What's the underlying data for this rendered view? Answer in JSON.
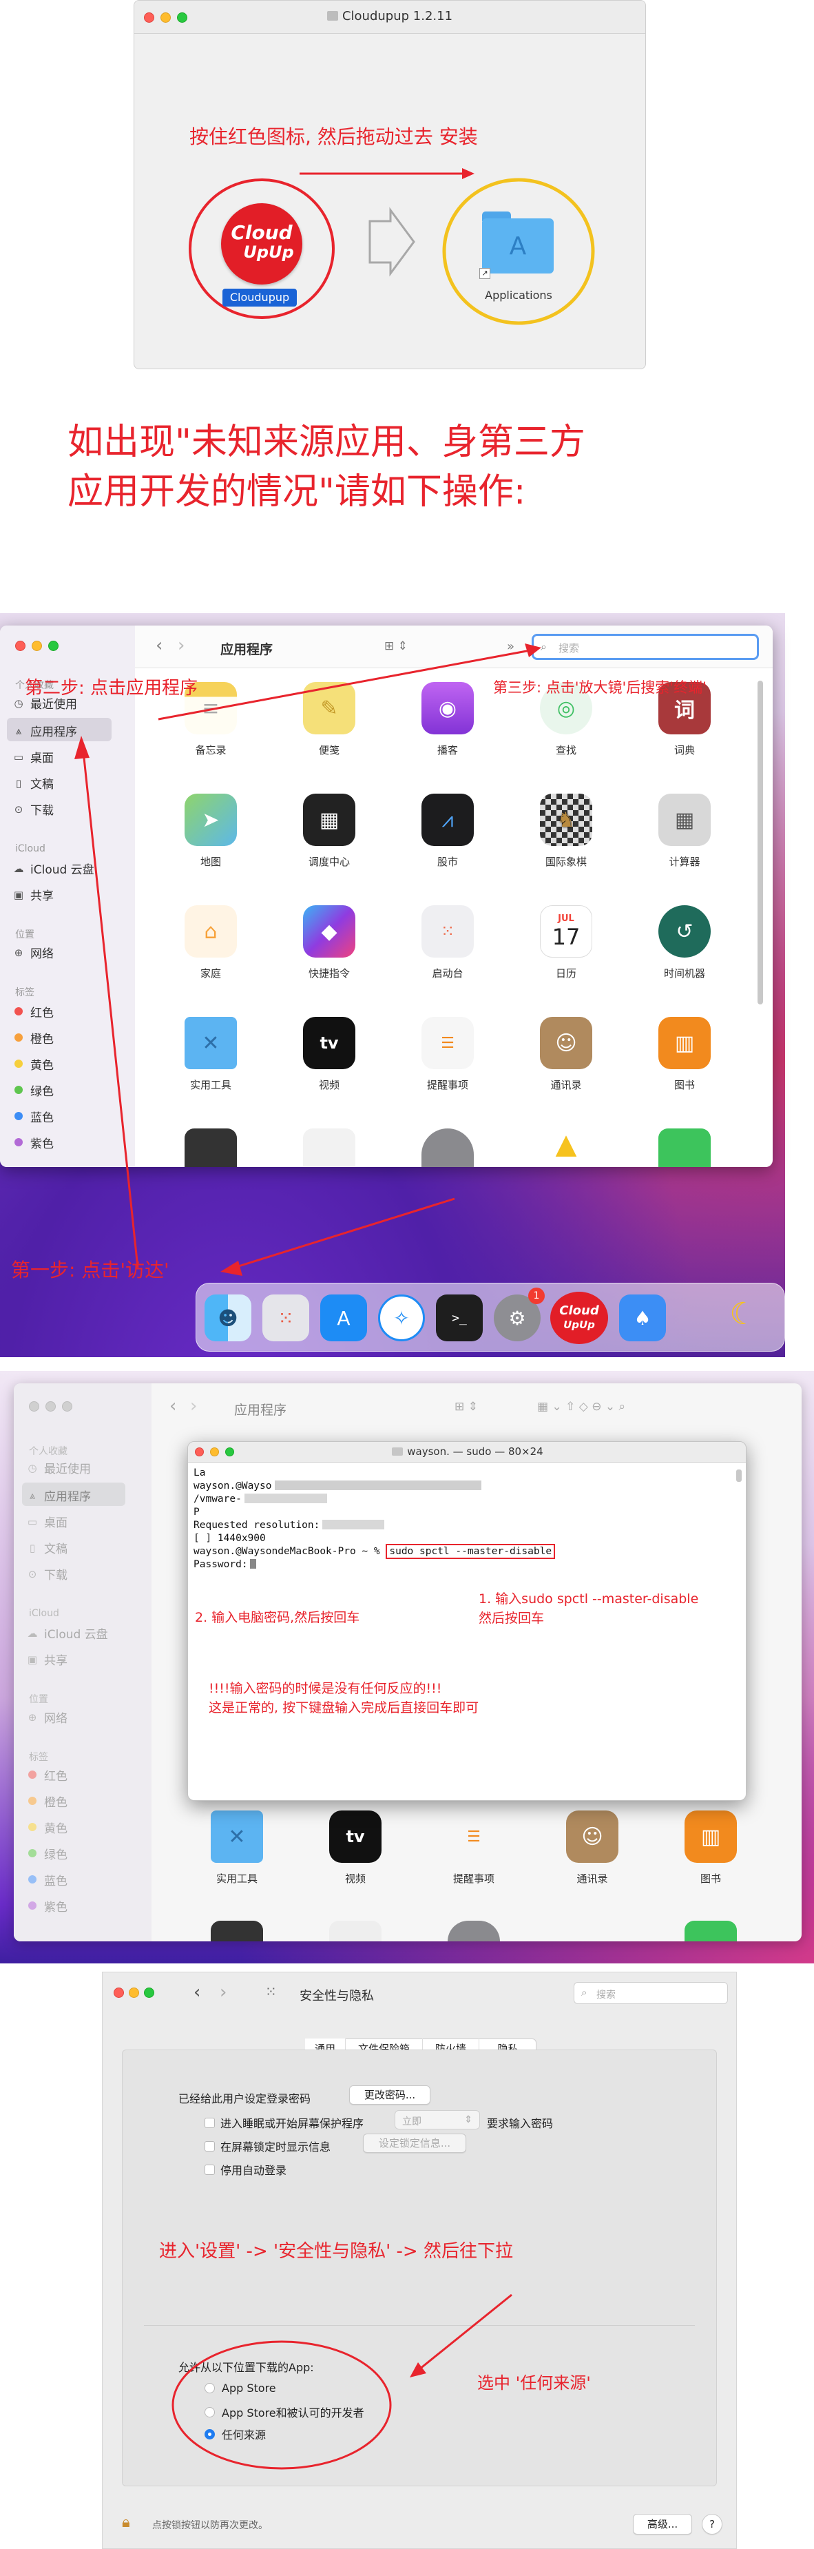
{
  "installer": {
    "window_title": "Cloudupup 1.2.11",
    "instruction": "按住红色图标, 然后拖动过去 安装",
    "app_icon_line1": "Cloud",
    "app_icon_line2": "UpUp",
    "app_label": "Cloudupup",
    "applications_label": "Applications"
  },
  "headline": {
    "line1": "如出现\"未知来源应用、身第三方",
    "line2": "应用开发的情况\"请如下操作:"
  },
  "finder": {
    "title": "应用程序",
    "search_placeholder": "搜索",
    "sidebar": {
      "favorites_title": "个人收藏",
      "favorites": [
        {
          "label": "最近使用",
          "icon": "clock-icon"
        },
        {
          "label": "应用程序",
          "icon": "apps-icon"
        },
        {
          "label": "桌面",
          "icon": "desktop-icon"
        },
        {
          "label": "文稿",
          "icon": "document-icon"
        },
        {
          "label": "下载",
          "icon": "download-icon"
        }
      ],
      "icloud_title": "iCloud",
      "icloud": [
        {
          "label": "iCloud 云盘",
          "icon": "cloud-icon"
        },
        {
          "label": "共享",
          "icon": "shared-folder-icon"
        }
      ],
      "location_title": "位置",
      "locations": [
        {
          "label": "网络",
          "icon": "network-icon"
        }
      ],
      "tags_title": "标签",
      "tags": [
        {
          "label": "红色",
          "color": "#f2524f"
        },
        {
          "label": "橙色",
          "color": "#f7a03c"
        },
        {
          "label": "黄色",
          "color": "#f6cf3c"
        },
        {
          "label": "绿色",
          "color": "#5fc54f"
        },
        {
          "label": "蓝色",
          "color": "#3d8df5"
        },
        {
          "label": "紫色",
          "color": "#b26ad6"
        }
      ]
    },
    "apps": [
      {
        "label": "备忘录",
        "icon": "notes-icon",
        "color": "#f6d25a"
      },
      {
        "label": "便笺",
        "icon": "stickies-icon",
        "color": "#f5e079"
      },
      {
        "label": "播客",
        "icon": "podcasts-icon",
        "color": "#9b4be0"
      },
      {
        "label": "查找",
        "icon": "findmy-icon",
        "color": "#3dbf62"
      },
      {
        "label": "词典",
        "icon": "dictionary-icon",
        "color": "#b23a3a"
      },
      {
        "label": "地图",
        "icon": "maps-icon",
        "color": "#5db8e8"
      },
      {
        "label": "调度中心",
        "icon": "mission-control-icon",
        "color": "#2a2a2a"
      },
      {
        "label": "股市",
        "icon": "stocks-icon",
        "color": "#1c1c1e"
      },
      {
        "label": "国际象棋",
        "icon": "chess-icon",
        "color": "#6a5a44"
      },
      {
        "label": "计算器",
        "icon": "calculator-icon",
        "color": "#8e8e93"
      },
      {
        "label": "家庭",
        "icon": "home-icon",
        "color": "#f7a23b"
      },
      {
        "label": "快捷指令",
        "icon": "shortcuts-icon",
        "color": "#5b5fe0"
      },
      {
        "label": "启动台",
        "icon": "launchpad-icon",
        "color": "#e5e5ea"
      },
      {
        "label": "日历",
        "icon": "calendar-icon",
        "color": "#ffffff"
      },
      {
        "label": "时间机器",
        "icon": "time-machine-icon",
        "color": "#2e7d6b"
      },
      {
        "label": "实用工具",
        "icon": "utilities-folder-icon",
        "color": "#4aa3e8"
      },
      {
        "label": "视频",
        "icon": "tv-icon",
        "color": "#111111"
      },
      {
        "label": "提醒事项",
        "icon": "reminders-icon",
        "color": "#f2f2f2"
      },
      {
        "label": "通讯录",
        "icon": "contacts-icon",
        "color": "#b08a5e"
      },
      {
        "label": "图书",
        "icon": "books-icon",
        "color": "#f28a1e"
      }
    ],
    "calendar_month": "JUL",
    "calendar_day": "17",
    "tv_text": "tv",
    "dict_char": "词"
  },
  "annotations": {
    "step1": "第一步: 点击'访达'",
    "step2": "第二步: 点击应用程序",
    "step3": "第三步: 点击'放大镜'后搜索'终端'"
  },
  "dock": {
    "badge_count": "1",
    "cloud_line1": "Cloud",
    "cloud_line2": "UpUp",
    "terminal_prompt": ">_"
  },
  "terminal": {
    "finder_title": "应用程序",
    "window_title": "wayson. — sudo — 80×24",
    "lines": [
      "La",
      "wayson.@Wayso",
      "/vmware-",
      "P",
      "Requested resolution:",
      "[      ]                1440x900",
      "wayson.@WaysondeMacBook-Pro ~ %"
    ],
    "command": "sudo spctl --master-disable",
    "password_line": "Password:",
    "step1": "1. 输入sudo spctl --master-disable",
    "step1_cont": "然后按回车",
    "step2": "2. 输入电脑密码,然后按回车",
    "note1": "!!!!输入密码的时候是没有任何反应的!!!",
    "note2": "这是正常的, 按下键盘输入完成后直接回车即可"
  },
  "security": {
    "title": "安全性与隐私",
    "search_placeholder": "搜索",
    "tabs": [
      "通用",
      "文件保险箱",
      "防火墙",
      "隐私"
    ],
    "login_password_text": "已经给此用户设定登录密码",
    "change_password_button": "更改密码...",
    "options": [
      "进入睡眠或开始屏幕保护程序",
      "在屏幕锁定时显示信息",
      "停用自动登录"
    ],
    "immediately": "立即",
    "require_password": "要求输入密码",
    "set_lock_message": "设定锁定信息...",
    "instruction": "进入'设置' -> '安全性与隐私' -> 然后往下拉",
    "allow_title": "允许从以下位置下载的App:",
    "allow_options": [
      "App Store",
      "App Store和被认可的开发者",
      "任何来源"
    ],
    "select_hint": "选中 '任何来源'",
    "lock_text": "点按锁按钮以防再次更改。",
    "advanced_button": "高级...",
    "help_button": "?"
  }
}
